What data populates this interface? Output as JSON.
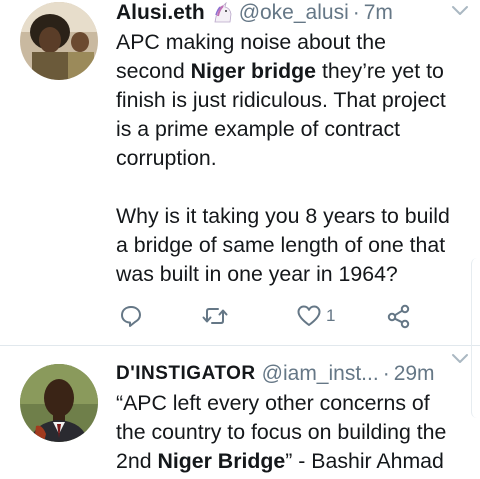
{
  "tweets": [
    {
      "display_name": "Alusi.eth",
      "name_emoji": "unicorn-emoji",
      "handle": "@oke_alusi",
      "separator": "·",
      "time": "7m",
      "text_lines": [
        {
          "pre": "APC making noise about the",
          "bold": "",
          "post": ""
        },
        {
          "pre": "second ",
          "bold": "Niger bridge",
          "post": " they’re yet to"
        },
        {
          "pre": "finish is just ridiculous. That project",
          "bold": "",
          "post": ""
        },
        {
          "pre": "is a prime example of contract",
          "bold": "",
          "post": ""
        },
        {
          "pre": "corruption.",
          "bold": "",
          "post": ""
        },
        {
          "pre": "Why is it taking you 8 years to build",
          "bold": "",
          "post": ""
        },
        {
          "pre": "a bridge of same length of one that",
          "bold": "",
          "post": ""
        },
        {
          "pre": "was built in one year in 1964?",
          "bold": "",
          "post": ""
        }
      ],
      "actions": {
        "reply_icon": "reply-icon",
        "retweet_icon": "retweet-icon",
        "like_icon": "like-icon",
        "like_count": "1",
        "share_icon": "share-icon"
      }
    },
    {
      "display_name": "D'INSTIGATOR",
      "handle": "@iam_inst...",
      "separator": "·",
      "time": "29m",
      "text_lines": [
        {
          "pre": "“APC left every other concerns of",
          "bold": "",
          "post": ""
        },
        {
          "pre": "the country to focus on building the",
          "bold": "",
          "post": ""
        },
        {
          "pre": "2nd ",
          "bold": "Niger Bridge",
          "post": "” - Bashir Ahmad"
        }
      ]
    }
  ],
  "colors": {
    "text": "#14171a",
    "secondary": "#657786",
    "divider": "#e1e8ed"
  }
}
